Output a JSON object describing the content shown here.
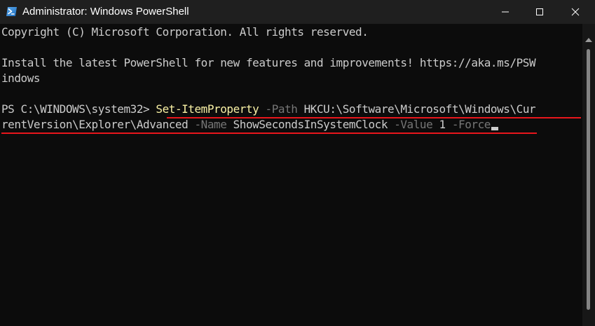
{
  "window": {
    "title": "Administrator: Windows PowerShell",
    "app_icon": "powershell-icon",
    "controls": {
      "minimize_icon": "minimize-icon",
      "maximize_icon": "maximize-icon",
      "close_icon": "close-icon"
    }
  },
  "console": {
    "copyright": "Copyright (C) Microsoft Corporation. All rights reserved.",
    "install_line1": "Install the latest PowerShell for new features and improvements! https://aka.ms/PSW",
    "install_line2": "indows",
    "prompt": "PS C:\\WINDOWS\\system32> ",
    "command": {
      "cmdlet": "Set-ItemProperty",
      "path_flag": "-Path",
      "path_value_part1": "HKCU:\\Software\\Microsoft\\Windows\\Cur",
      "path_value_part2": "rentVersion\\Explorer\\Advanced",
      "name_flag": "-Name",
      "name_value": "ShowSecondsInSystemClock",
      "value_flag": "-Value",
      "value_value": "1",
      "force_flag": "-Force"
    }
  },
  "colors": {
    "background": "#0c0c0c",
    "titlebar": "#1f1f1f",
    "text": "#cccccc",
    "cmdlet": "#f9f1a5",
    "parameter": "#767676",
    "underline": "#e8161c"
  }
}
